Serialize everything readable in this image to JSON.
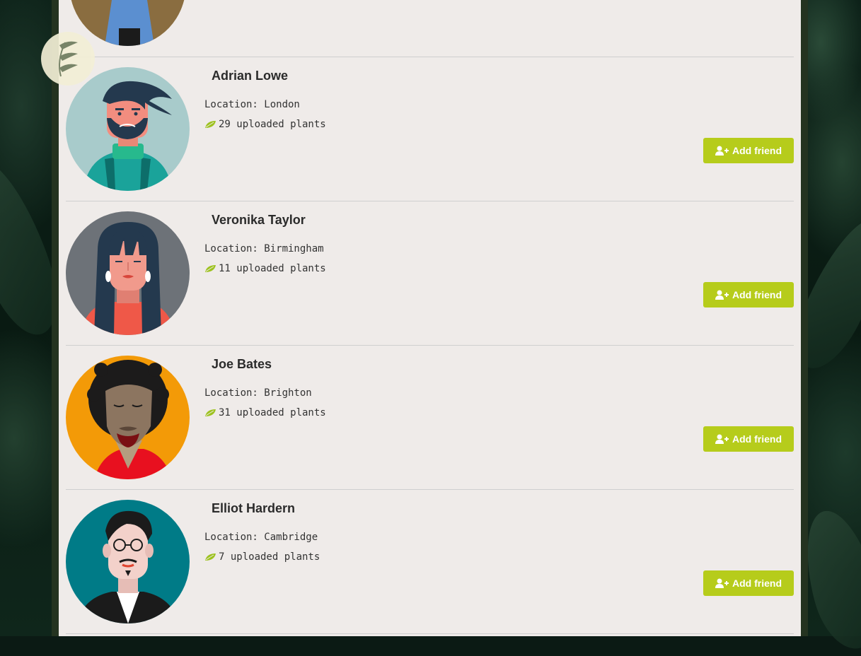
{
  "colors": {
    "accent": "#b6cc1b",
    "panel": "#efebe9",
    "divider": "#cfcfcf",
    "text": "#2b2b2b",
    "leaf": "#9dc21f"
  },
  "logo": {
    "icon": "leaves-logo-icon"
  },
  "add_friend_icon": "user-plus-icon",
  "plant_icon": "leaf-icon",
  "users": [
    {
      "name": "Adrian Lowe",
      "location": "Location: London",
      "plants": "29 uploaded plants",
      "button": "Add friend",
      "avatar_bg": "#a8cbcb"
    },
    {
      "name": "Veronika Taylor",
      "location": "Location: Birmingham",
      "plants": "11 uploaded plants",
      "button": "Add friend",
      "avatar_bg": "#6d7278"
    },
    {
      "name": "Joe Bates",
      "location": "Location: Brighton",
      "plants": "31 uploaded plants",
      "button": "Add friend",
      "avatar_bg": "#f39a07"
    },
    {
      "name": "Elliot Hardern",
      "location": "Location: Cambridge",
      "plants": "7 uploaded plants",
      "button": "Add friend",
      "avatar_bg": "#007b87"
    }
  ]
}
